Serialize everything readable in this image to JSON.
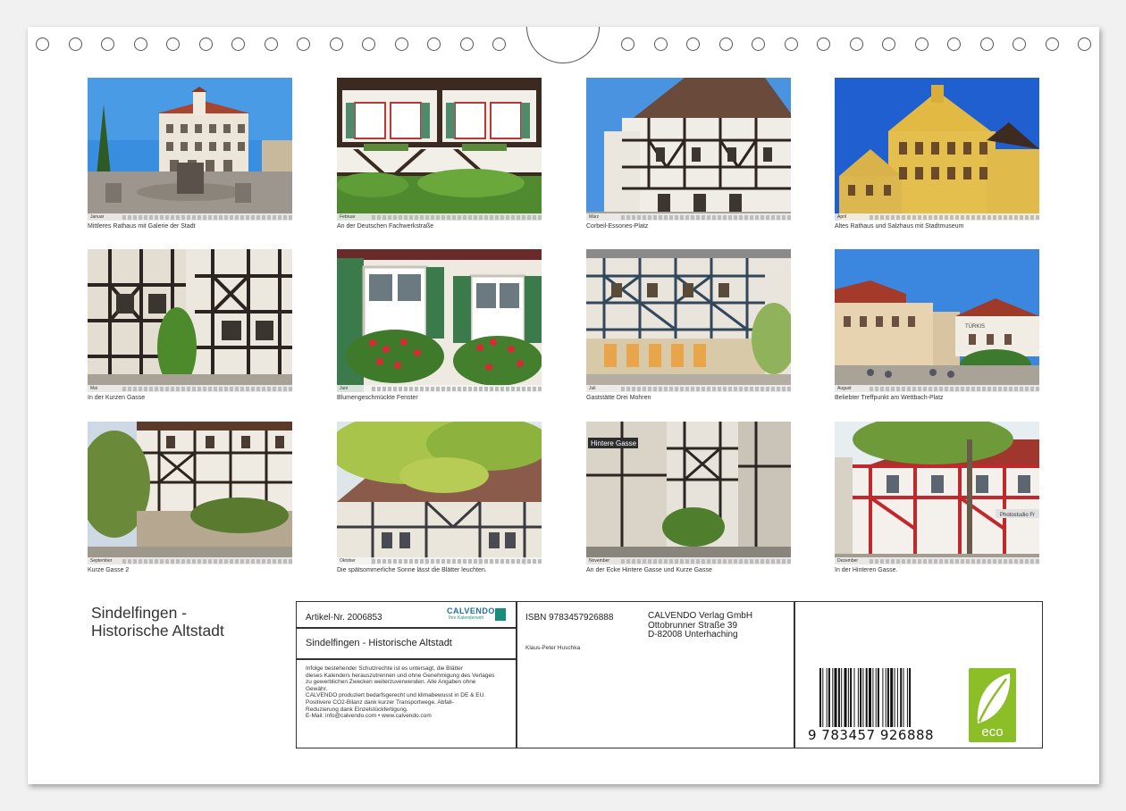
{
  "calendar_title": [
    "Sindelfingen -",
    "Historische Altstadt"
  ],
  "months": [
    "Januar",
    "Februar",
    "März",
    "April",
    "Mai",
    "Juni",
    "Juli",
    "August",
    "September",
    "Oktober",
    "November",
    "Dezember"
  ],
  "captions": [
    "Mittleres Rathaus mit Galerie der Stadt",
    "An der Deutschen Fachwerkstraße",
    "Corbeil-Essones-Platz",
    "Altes Rathaus und Salzhaus mit Stadtmuseum",
    "In der Kurzen Gasse",
    "Blumengeschmückte Fenster",
    "Gaststätte Drei Mohren",
    "Beliebter Treffpunkt am Wettbach-Platz",
    "Kurze Gasse 2",
    "Die spätsommerliche Sonne lässt die Blätter leuchten.",
    "An der Ecke Hintere Gasse und Kurze Gasse",
    "In der Hinteren Gasse."
  ],
  "photo_signs": {
    "hintere_gasse": "Hintere Gasse",
    "tuerkis": "TÜRKIS",
    "photostudio": "Photostudio Fr"
  },
  "info": {
    "article": "Artikel-Nr. 2006853",
    "product_title": "Sindelfingen - Historische Altstadt",
    "legal": [
      "Infolge bestehender Schutzrechte ist es untersagt, die Blätter",
      "dieses Kalenders herauszutrennen und ohne Genehmigung des Verlages",
      "zu gewerblichen Zwecken weiterzuverwenden. Alle Angaben ohne",
      "Gewähr.",
      "CALVENDO produziert bedarfsgerecht und klimabewusst in DE & EU.",
      "Positivere CO2-Bilanz dank kurzer Transportwege. Abfall-",
      "Reduzierung dank Einzelstückfertigung.",
      "E-Mail: info@calvendo.com • www.calvendo.com"
    ],
    "isbn": "ISBN 9783457926888",
    "author": "Klaus-Peter Huschka",
    "publisher": [
      "CALVENDO Verlag GmbH",
      "Ottobrunner Straße 39",
      "D-82008 Unterhaching"
    ],
    "barcode_number": "9 783457 926888",
    "brand": "CALVENDO",
    "brand_sub": "Ihre Kalenderwelt",
    "eco_label": "eco"
  },
  "colors": {
    "sky": "#2f7fd4",
    "timber": "#3a2a20",
    "plaster": "#f2efe8",
    "red_timber": "#c0282b",
    "foliage": "#4f8a2f",
    "eco_green": "#8cbe27"
  }
}
